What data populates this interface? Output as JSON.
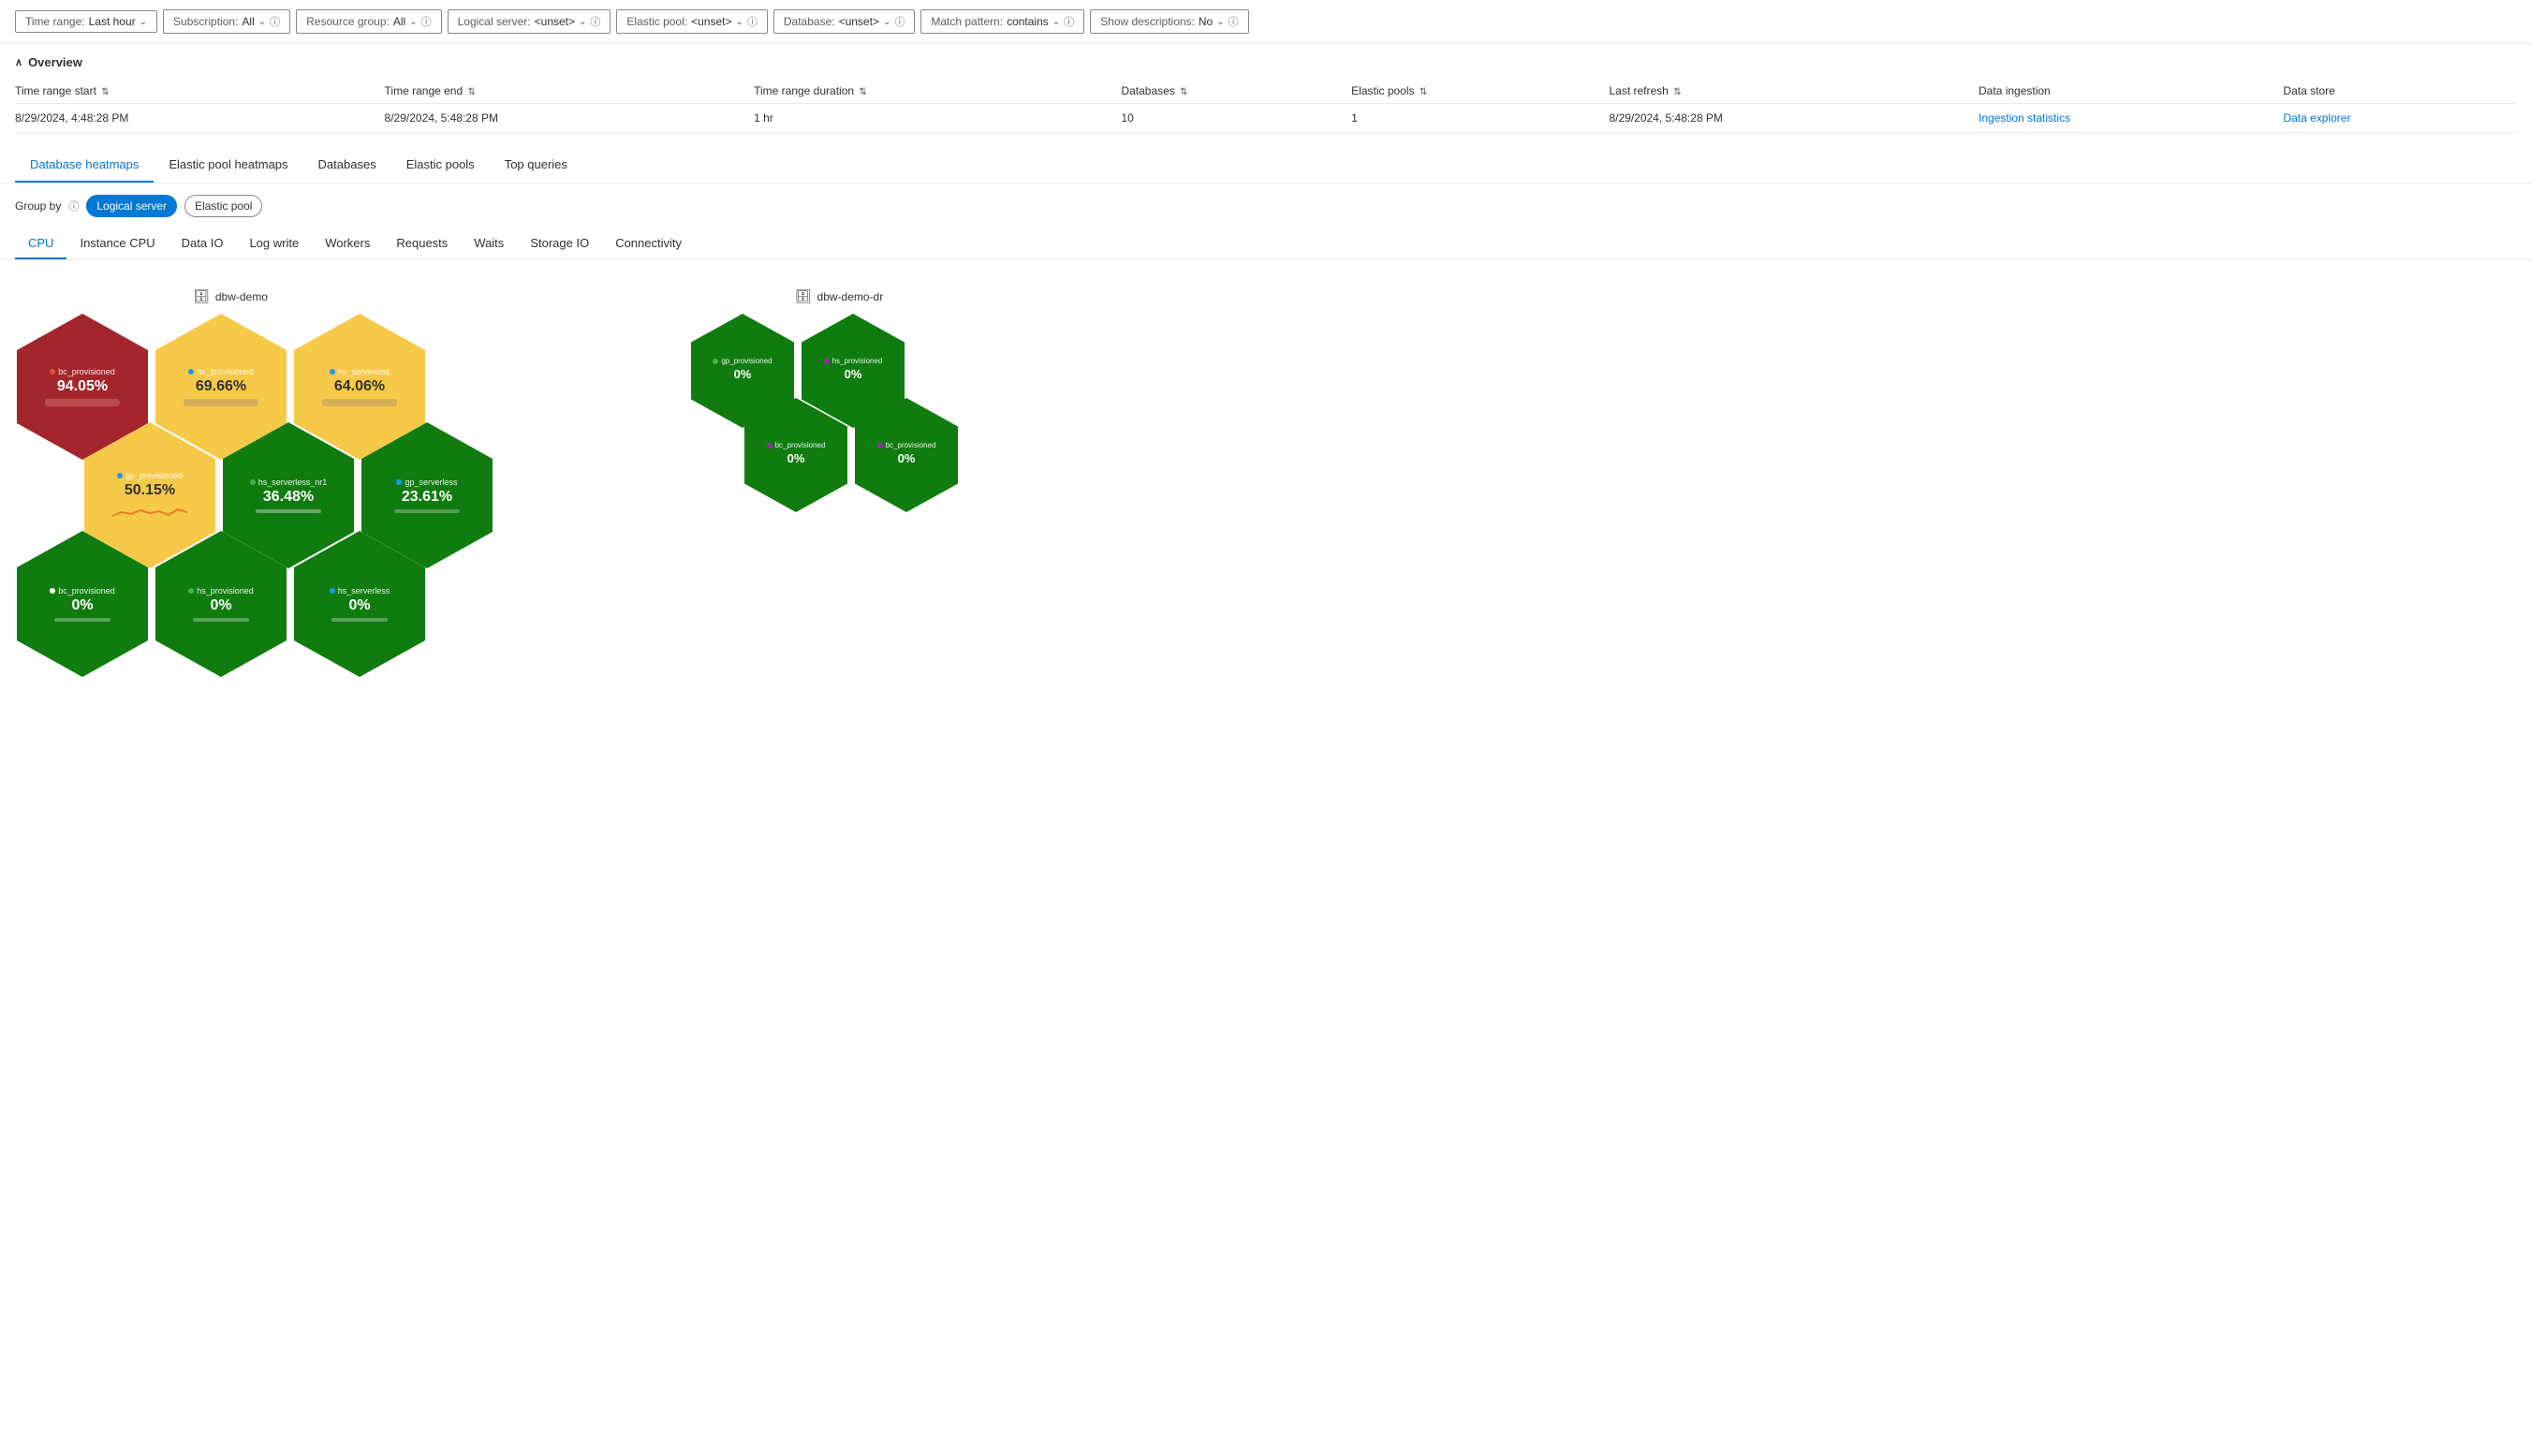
{
  "filters": {
    "time_range_label": "Time range:",
    "time_range_value": "Last hour",
    "subscription_label": "Subscription:",
    "subscription_value": "All",
    "resource_group_label": "Resource group:",
    "resource_group_value": "All",
    "logical_server_label": "Logical server:",
    "logical_server_value": "<unset>",
    "elastic_pool_label": "Elastic pool:",
    "elastic_pool_value": "<unset>",
    "database_label": "Database:",
    "database_value": "<unset>",
    "match_pattern_label": "Match pattern:",
    "match_pattern_value": "contains",
    "show_descriptions_label": "Show descriptions:",
    "show_descriptions_value": "No"
  },
  "overview": {
    "section_title": "Overview",
    "columns": [
      "Time range start",
      "Time range end",
      "Time range duration",
      "Databases",
      "Elastic pools",
      "Last refresh",
      "Data ingestion",
      "Data store"
    ],
    "row": {
      "time_range_start": "8/29/2024, 4:48:28 PM",
      "time_range_end": "8/29/2024, 5:48:28 PM",
      "duration": "1 hr",
      "databases": "10",
      "elastic_pools": "1",
      "last_refresh": "8/29/2024, 5:48:28 PM",
      "data_ingestion": "Ingestion statistics",
      "data_store": "Data explorer"
    }
  },
  "main_tabs": [
    "Database heatmaps",
    "Elastic pool heatmaps",
    "Databases",
    "Elastic pools",
    "Top queries"
  ],
  "active_main_tab": 0,
  "group_by": {
    "label": "Group by",
    "options": [
      "Logical server",
      "Elastic pool"
    ],
    "active": 0
  },
  "metric_tabs": [
    "CPU",
    "Instance CPU",
    "Data IO",
    "Log write",
    "Workers",
    "Requests",
    "Waits",
    "Storage IO",
    "Connectivity"
  ],
  "active_metric_tab": 0,
  "server1": {
    "name": "dbw-demo",
    "icon": "🗄",
    "hexagons": [
      {
        "row": 0,
        "cells": [
          {
            "name": "bc_provisioned",
            "value": "94.05%",
            "color": "red",
            "dot_color": "#e00"
          },
          {
            "name": "hs_provisioned",
            "value": "69.66%",
            "color": "yellow",
            "dot_color": "#2196f3"
          },
          {
            "name": "hs_serverless",
            "value": "64.06%",
            "color": "yellow",
            "dot_color": "#2196f3"
          }
        ]
      },
      {
        "row": 1,
        "cells": [
          {
            "name": "gp_provisioned",
            "value": "50.15%",
            "color": "yellow",
            "dot_color": "#2196f3"
          },
          {
            "name": "hs_serverless_nr1",
            "value": "36.48%",
            "color": "green",
            "dot_color": "#4caf50"
          },
          {
            "name": "gp_serverless",
            "value": "23.61%",
            "color": "green",
            "dot_color": "#2196f3"
          }
        ]
      },
      {
        "row": 2,
        "cells": [
          {
            "name": "bc_provisioned",
            "value": "0%",
            "color": "green",
            "dot_color": "#fff"
          },
          {
            "name": "hs_provisioned",
            "value": "0%",
            "color": "green",
            "dot_color": "#4caf50"
          },
          {
            "name": "hs_serverless",
            "value": "0%",
            "color": "green",
            "dot_color": "#2196f3"
          }
        ]
      }
    ]
  },
  "server2": {
    "name": "dbw-demo-dr",
    "icon": "🗄",
    "hexagons": [
      {
        "row": 0,
        "cells": [
          {
            "name": "gp_provisioned",
            "value": "0%",
            "color": "green",
            "dot_color": "#4caf50"
          },
          {
            "name": "hs_provisioned",
            "value": "0%",
            "color": "green",
            "dot_color": "#9c27b0"
          }
        ]
      },
      {
        "row": 1,
        "cells": [
          {
            "name": "bc_provisioned",
            "value": "0%",
            "color": "green",
            "dot_color": "#9c27b0"
          },
          {
            "name": "bc_provisioned",
            "value": "0%",
            "color": "green",
            "dot_color": "#9c27b0"
          }
        ]
      }
    ]
  }
}
